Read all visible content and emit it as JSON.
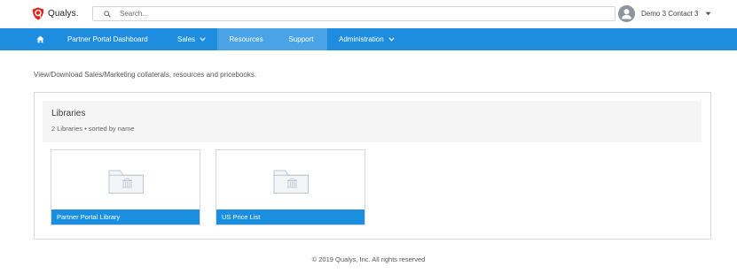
{
  "header": {
    "brand": "Qualys.",
    "search_placeholder": "Search...",
    "user_name": "Demo 3 Contact 3"
  },
  "nav": {
    "items": [
      {
        "label": "Partner Portal Dashboard"
      },
      {
        "label": "Sales"
      },
      {
        "label": "Resources"
      },
      {
        "label": "Support"
      },
      {
        "label": "Administration"
      }
    ],
    "active": "Resources"
  },
  "content": {
    "intro": "View/Download Sales/Marketing collaterals, resources and pricebooks.",
    "libraries": {
      "title": "Libraries",
      "subtitle": "2 Libraries • sorted by name",
      "items": [
        {
          "name": "Partner Portal Library",
          "icon": "folder-library-icon"
        },
        {
          "name": "US Price List",
          "icon": "folder-library-icon"
        }
      ]
    }
  },
  "footer": {
    "copyright": "© 2019 Qualys, Inc. All rights reserved"
  },
  "colors": {
    "nav_bg": "#1f8ddf",
    "nav_active": "#4aa3e6",
    "card_label": "#1a8fe0",
    "brand_red": "#e2231a"
  }
}
